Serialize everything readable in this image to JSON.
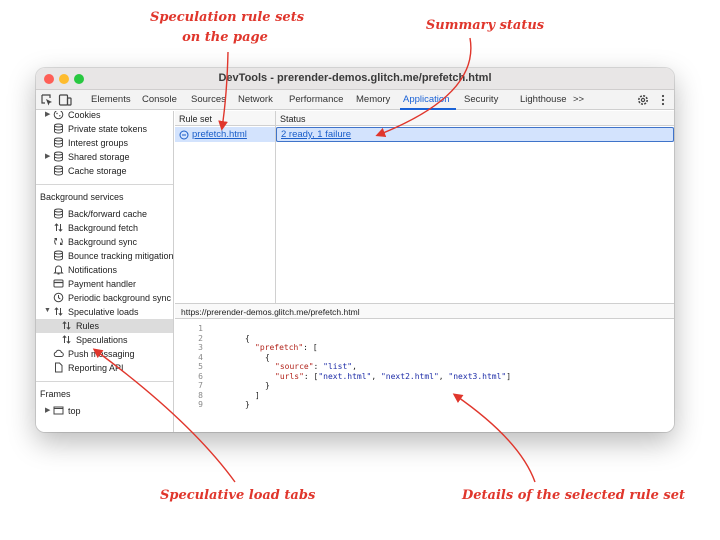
{
  "annotations": {
    "rule_sets_line1": "Speculation rule sets",
    "rule_sets_line2": "on the page",
    "summary_status": "Summary status",
    "speculative_tabs": "Speculative load tabs",
    "details": "Details of the selected rule set"
  },
  "window": {
    "title": "DevTools - prerender-demos.glitch.me/prefetch.html"
  },
  "toolbar": {
    "tabs": [
      "Elements",
      "Console",
      "Sources",
      "Network",
      "Performance",
      "Memory",
      "Application",
      "Security",
      "Lighthouse"
    ],
    "more": ">>",
    "active": "Application"
  },
  "sidebar": {
    "storage_items": [
      "Cookies",
      "Private state tokens",
      "Interest groups",
      "Shared storage",
      "Cache storage"
    ],
    "background_header": "Background services",
    "background_items": [
      "Back/forward cache",
      "Background fetch",
      "Background sync",
      "Bounce tracking mitigations",
      "Notifications",
      "Payment handler",
      "Periodic background sync",
      "Speculative loads"
    ],
    "speculative_children": [
      "Rules",
      "Speculations"
    ],
    "other_items": [
      "Push messaging",
      "Reporting API"
    ],
    "frames_header": "Frames",
    "frames_items": [
      "top"
    ]
  },
  "table": {
    "headers": [
      "Rule set",
      "Status"
    ],
    "rows": [
      {
        "rule_set": "prefetch.html",
        "status": "2 ready, 1 failure"
      }
    ]
  },
  "detail": {
    "url": "https://prerender-demos.glitch.me/prefetch.html",
    "line_numbers": [
      "1",
      "2",
      "3",
      "4",
      "5",
      "6",
      "7",
      "8",
      "9"
    ],
    "code": {
      "open_brace": "{",
      "prefetch_key": "\"prefetch\"",
      "open_list": ": [",
      "inner_open": "{",
      "source_key": "\"source\"",
      "source_val": "\"list\"",
      "urls_key": "\"urls\"",
      "url1": "\"next.html\"",
      "url2": "\"next2.html\"",
      "url3": "\"next3.html\"",
      "inner_close": "}",
      "close_list": "]",
      "close_brace": "}"
    }
  },
  "colors": {
    "annotation": "#e0362c",
    "accent": "#1a62d6",
    "selection": "#d3e3fd"
  }
}
